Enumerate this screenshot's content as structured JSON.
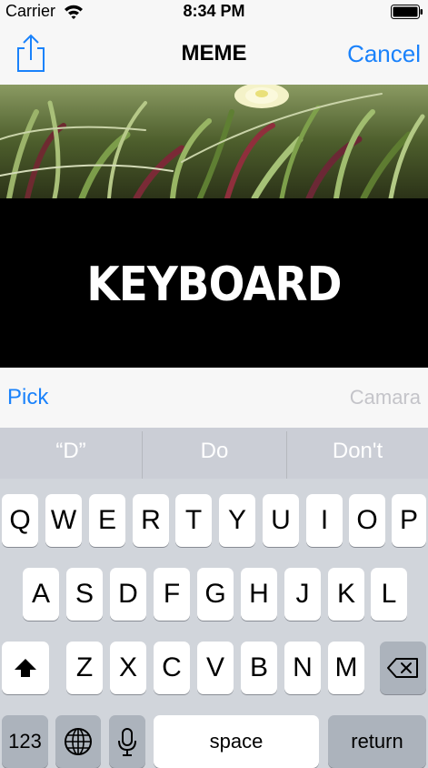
{
  "status_bar": {
    "carrier": "Carrier",
    "time": "8:34 PM"
  },
  "nav": {
    "title": "MEME",
    "cancel_label": "Cancel",
    "share_icon": "share-icon"
  },
  "meme": {
    "text": "KEYBOARD"
  },
  "toolbar": {
    "pick_label": "Pick",
    "camera_label": "Camara"
  },
  "keyboard": {
    "suggestions": [
      "“D”",
      "Do",
      "Don't"
    ],
    "row1": [
      "Q",
      "W",
      "E",
      "R",
      "T",
      "Y",
      "U",
      "I",
      "O",
      "P"
    ],
    "row2": [
      "A",
      "S",
      "D",
      "F",
      "G",
      "H",
      "J",
      "K",
      "L"
    ],
    "row3": [
      "Z",
      "X",
      "C",
      "V",
      "B",
      "N",
      "M"
    ],
    "numbers_label": "123",
    "space_label": "space",
    "return_label": "return",
    "icons": [
      "shift-icon",
      "delete-icon",
      "globe-icon",
      "microphone-icon"
    ]
  }
}
